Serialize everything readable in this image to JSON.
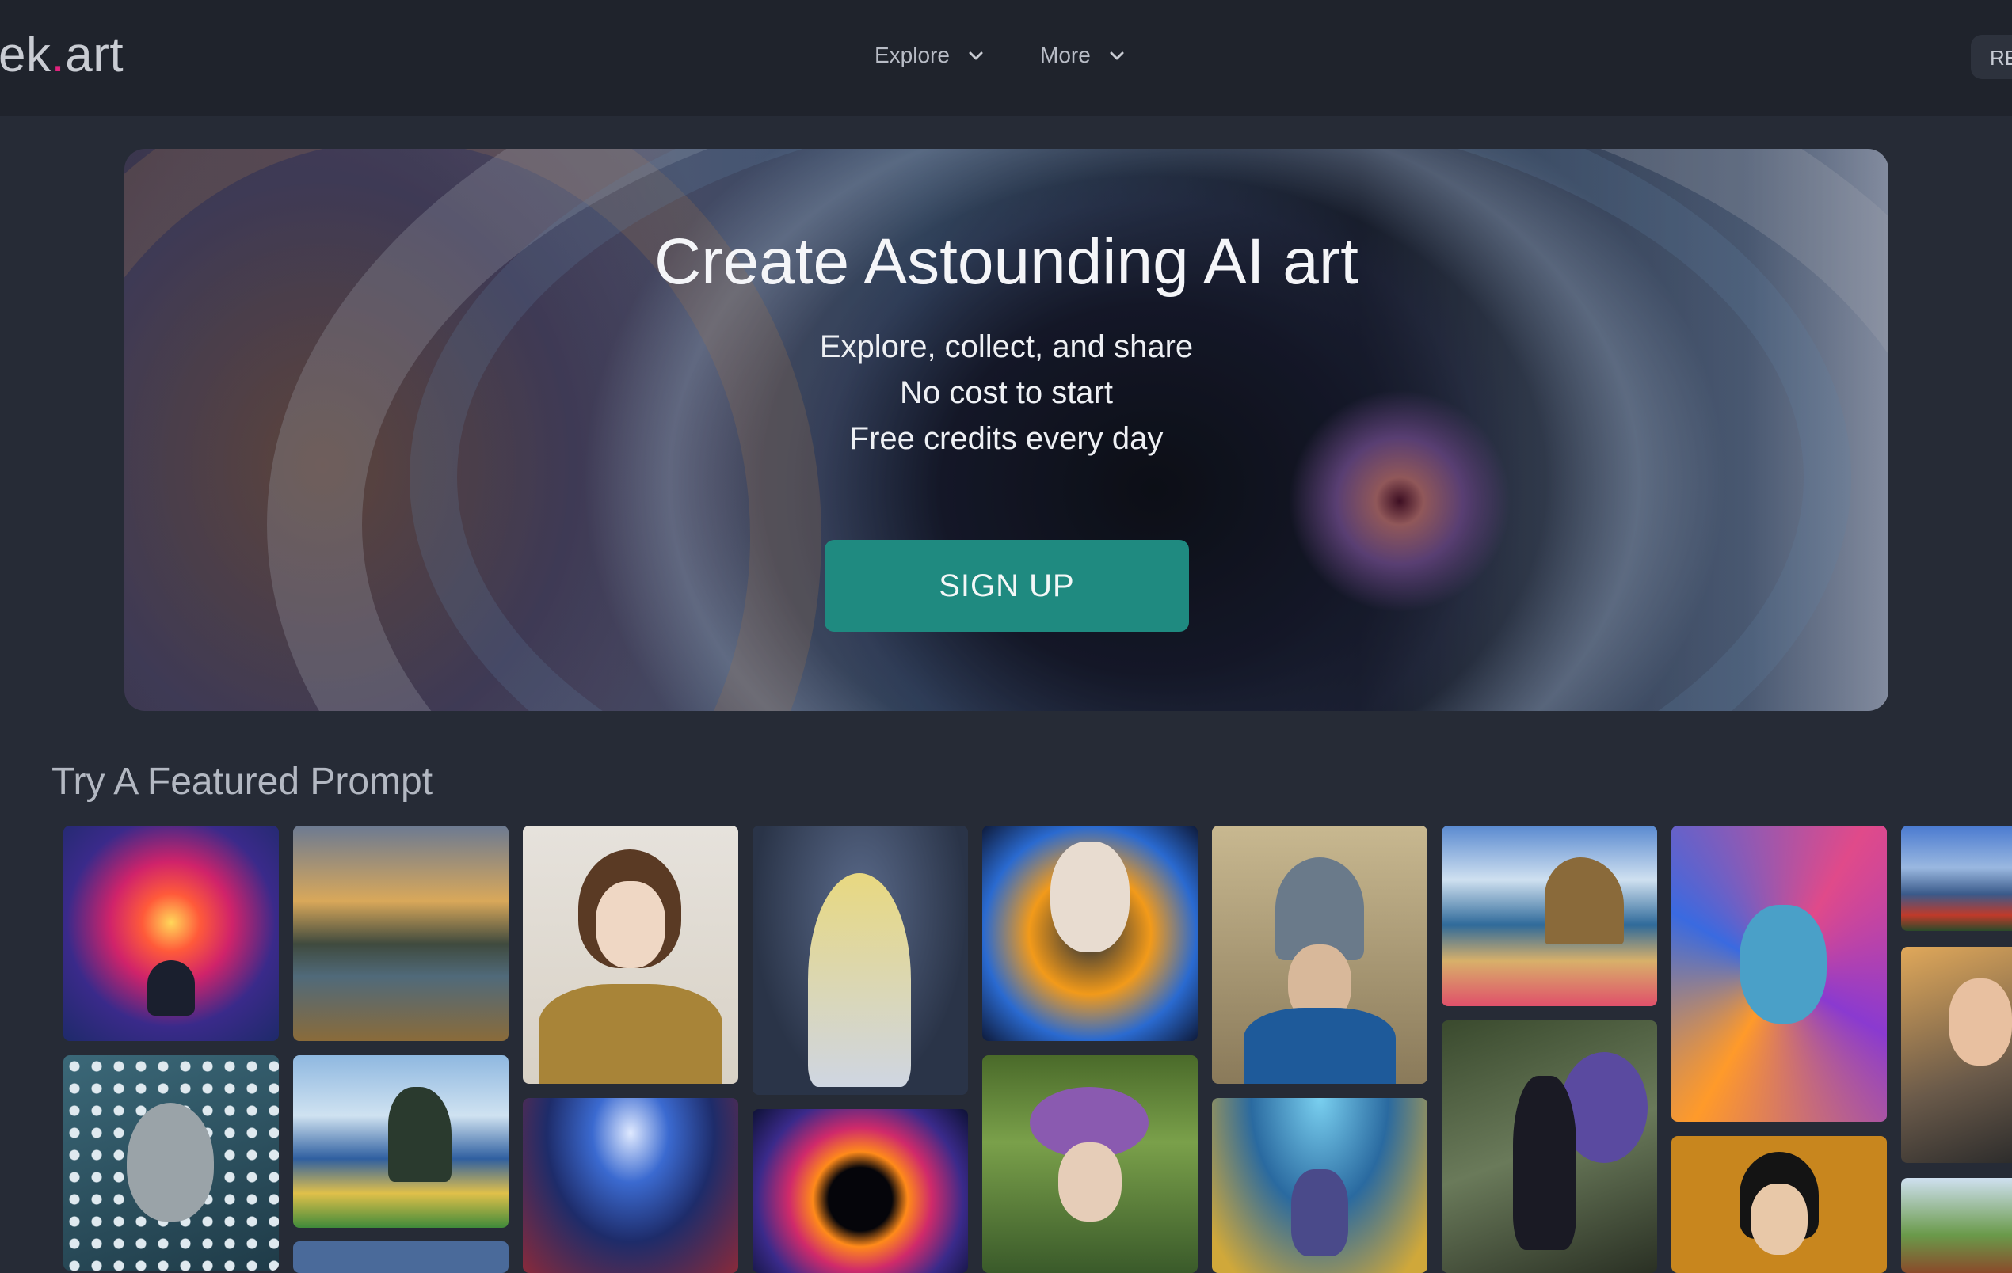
{
  "header": {
    "logo_text": "ek",
    "logo_dot": ".",
    "logo_suffix": "art",
    "nav": [
      {
        "label": "Explore"
      },
      {
        "label": "More"
      }
    ],
    "right_button_label": "RE"
  },
  "hero": {
    "title": "Create Astounding AI art",
    "lines": [
      "Explore, collect, and share",
      "No cost to start",
      "Free credits every day"
    ],
    "cta_label": "SIGN UP"
  },
  "featured": {
    "title": "Try A Featured Prompt"
  },
  "colors": {
    "accent": "#1f8a80",
    "logo_dot": "#e0237d",
    "background": "#262b36",
    "header_bg": "#1f232c"
  }
}
